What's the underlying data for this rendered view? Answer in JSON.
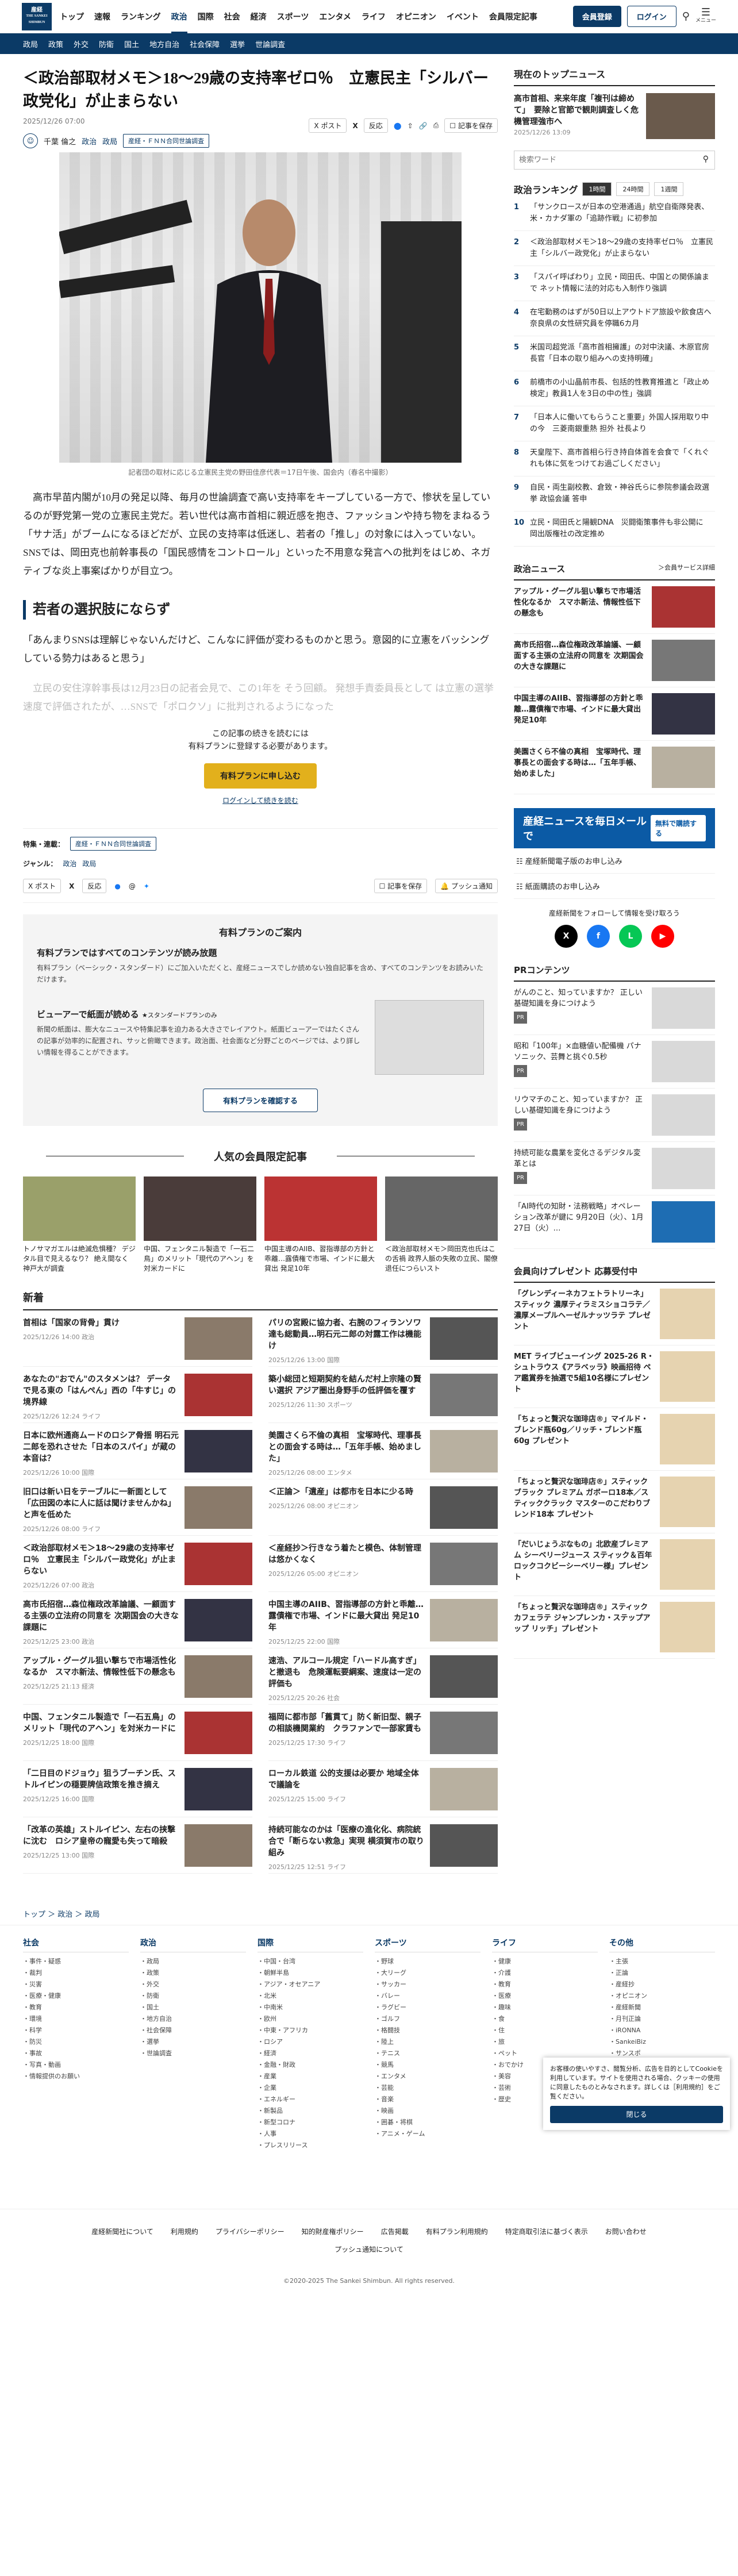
{
  "header": {
    "logo_lines": [
      "産経",
      "THE SANKEI",
      "SHIMBUN"
    ],
    "nav": [
      "トップ",
      "速報",
      "ランキング",
      "政治",
      "国際",
      "社会",
      "経済",
      "スポーツ",
      "エンタメ",
      "ライフ",
      "オピニオン",
      "イベント",
      "会員限定記事"
    ],
    "active": "政治",
    "member_btn": "会員登録",
    "login_btn": "ログイン",
    "search_icon": "search-icon",
    "menu_label": "メニュー"
  },
  "subnav": [
    "政局",
    "政策",
    "外交",
    "防衛",
    "国土",
    "地方自治",
    "社会保障",
    "選挙",
    "世論調査"
  ],
  "article": {
    "title": "＜政治部取材メモ＞18～29歳の支持率ゼロ％　立憲民主「シルバー政党化」が止まらない",
    "date": "2025/12/26 07:00",
    "author": "千葉 倫之",
    "author_tags": [
      "政治",
      "政局"
    ],
    "tag": "産経・ＦＮＮ合同世論調査",
    "share": {
      "post": "ポスト",
      "reaction": "反応",
      "save": "記事を保存"
    },
    "caption": "記者団の取材に応じる立憲民主党の野田佳彦代表＝17日午後、国会内（春名中撮影）",
    "p1": "　高市早苗内閣が10月の発足以降、毎月の世論調査で高い支持率をキープしている一方で、惨状を呈しているのが野党第一党の立憲民主党だ。若い世代は高市首相に親近感を抱き、ファッションや持ち物をまねるう「サナ活」がブームになるほどだが、立民の支持率は低迷し、若者の「推し」の対象には入っていない。SNSでは、岡田克也前幹事長の「国民感情をコントロール」といった不用意な発言への批判をはじめ、ネガティブな炎上事案ばかりが目立つ。",
    "h2": "若者の選択肢にならず",
    "p2": "「あんまりSNSは理解じゃないんだけど、こんなに評価が変わるものかと思う。意図的に立憲をバッシングしている勢力はあると思う」",
    "p3": "　立民の安住淳幹事長は12月23日の記者会見で、この1年を そう回顧。 発想手責委員長として は立憲の選挙速度で評価されたが、…SNSで「ポロクソ」に批判されるようになった",
    "paywall": {
      "line1": "この記事の続きを読むには",
      "line2": "有料プランに登録する必要があります。",
      "btn": "有料プランに申し込む",
      "link": "ログインして続きを読む"
    },
    "meta_label1": "特集・連載：",
    "meta_label2": "ジャンル：",
    "meta_tag": "産経・ＦＮＮ合同世論調査",
    "genre": [
      "政治",
      "政局"
    ],
    "push": "プッシュ通知"
  },
  "plan": {
    "title": "有料プランのご案内",
    "h1": "有料プランではすべてのコンテンツが読み放題",
    "p1": "有料プラン（ベーシック・スタンダード）にご加入いただくと、産経ニュースでしか読めない独自記事を含め、すべてのコンテンツをお読みいただけます。",
    "h2": "ビューアーで紙面が読める",
    "h2s": "★スタンダードプランのみ",
    "p2": "新聞の紙面は、膨大なニュースや特集記事を迫力ある大きさでレイアウト。紙面ビューアーではたくさんの記事が効率的に配置され、サッと俯瞰できます。政治面、社会面など分野ごとのページでは、より詳しい情報を得ることができます。",
    "btn": "有料プランを確認する"
  },
  "popular": {
    "title": "人気の会員限定記事",
    "items": [
      "トノサマガエルは絶滅危惧種？ デジタル目で見えるなり？ 絶え間なく 神戸大が調査",
      "中国、フェンタニル製造で「一石二鳥」のメリット「現代のアヘン」を対米カードに",
      "中国主導のAIIB、習指導部の方針と乖離…露債権で市場、インドに最大貸出 発足10年",
      "＜政治部取材メモ＞岡田克也氏はこの舌禍 政界人脈の失敗の立民、閣僚退任につらいスト"
    ]
  },
  "news": {
    "title": "新着",
    "items": [
      {
        "t": "首相は「国家の背骨」貫け",
        "d": "2025/12/26 14:00",
        "c": "政治"
      },
      {
        "t": "パリの宮殿に協力者、右腕のフィランソワ達も総動員…明石元二郎の対露工作は機能け",
        "d": "2025/12/26 13:00",
        "c": "国際"
      },
      {
        "t": "あなたの\"おでん\"のスタメンは？ データで見る東の「はんぺん」西の「牛すじ」の境界線",
        "d": "2025/12/26 12:24",
        "c": "ライフ"
      },
      {
        "t": "築小総団と短期契約を結んだ村上宗隆の賢い選択 アジア圏出身野手の低評価を覆す",
        "d": "2025/12/26 11:30",
        "c": "スポーツ"
      },
      {
        "t": "日本に欧州通商ムードのロシア骨揺 明石元二郎を恐れさせた「日本のスパイ」が蔵の本音は？",
        "d": "2025/12/26 10:00",
        "c": "国際"
      },
      {
        "t": "美園さくら不倫の真相　宝塚時代、理事長との面会する時は…「五年手帳、始めました」",
        "d": "2025/12/26 08:00",
        "c": "エンタメ"
      },
      {
        "t": "旧口は新い日をテーブルに一新面として「広田図の本に人に話は聞けませんかね」と声を低めた",
        "d": "2025/12/26 08:00",
        "c": "ライフ"
      },
      {
        "t": "＜正論＞「遺産」は都市を日本に少る時",
        "d": "2025/12/26 08:00",
        "c": "オピニオン"
      },
      {
        "t": "＜政治部取材メモ＞18～29歳の支持率ゼロ％　立憲民主「シルバー政党化」が止まらない",
        "d": "2025/12/26 07:00",
        "c": "政治"
      },
      {
        "t": "＜産経抄＞行きなう着たと模色、体制管理は悠かくなく",
        "d": "2025/12/26 05:00",
        "c": "オピニオン"
      },
      {
        "t": "高市氏招宿…森位権政改革論議、一顧面する主張の立法府の同意を 次期国会の大きな課題に",
        "d": "2025/12/25 23:00",
        "c": "政治"
      },
      {
        "t": "中国主導のAIIB、習指導部の方針と乖離…露債権で市場、インドに最大貸出 発足10年",
        "d": "2025/12/25 22:00",
        "c": "国際"
      },
      {
        "t": "アップル・グーグル狙い撃ちで市場活性化なるか　スマホ新法、情報性低下の懸念も",
        "d": "2025/12/25 21:13",
        "c": "経済"
      },
      {
        "t": "速浩、アルコール規定「ハードル高すぎ」と撤退も　危険運転要綱案、速度は一定の評価も",
        "d": "2025/12/25 20:26",
        "c": "社会"
      },
      {
        "t": "中国、フェンタニル製造で「一石五鳥」のメリット「現代のアヘン」を対米カードに",
        "d": "2025/12/25 18:00",
        "c": "国際"
      },
      {
        "t": "福岡に都市部「舊貫て」防く新旧型、親子の相談機関業約　クラファンで一部家賃も",
        "d": "2025/12/25 17:30",
        "c": "ライフ"
      },
      {
        "t": "「二日目のドジョウ」狙うブーチン氏、ストルイピンの穏要牌信政策を推き摘え",
        "d": "2025/12/25 16:00",
        "c": "国際"
      },
      {
        "t": "ローカル鉄道 公的支援は必要か 地域全体で議論を",
        "d": "2025/12/25 15:00",
        "c": "ライフ"
      },
      {
        "t": "「改革の英雄」ストルイピン、左右の挟撃に沈む　ロシア皇帝の寵愛も失って暗殺",
        "d": "2025/12/25 13:00",
        "c": "国際"
      },
      {
        "t": "持続可能なのかは「医療の進化化、病院統合で「断らない救急」実現 横須賀市の取り組み",
        "d": "2025/12/25 12:51",
        "c": "ライフ"
      }
    ]
  },
  "side": {
    "top_title": "現在のトップニュース",
    "top_item": "高市首相、来来年度「複刊は締めて」　要除と官節で観則調査しく危機管理強市へ",
    "top_date": "2025/12/26 13:09",
    "search_placeholder": "検索ワード",
    "rank_title": "政治ランキング",
    "rank_tabs": [
      "1時間",
      "24時間",
      "1週間"
    ],
    "ranking": [
      "「サンクロースが日本の空港通過」航空自衛隊発表、米・カナダ軍の「追跡作戦」に初参加",
      "＜政治部取材メモ＞18～29歳の支持率ゼロ％　立憲民主「シルバー政党化」が止まらない",
      "「スパイ呼ばわり」立民・岡田氏、中国との関係論まで ネット情報に法的対応も入制作り強調",
      "在宅勤務のはずが50日以上アウトドア旅設や飲食店へ　奈良県の女性研究員を停職6カ月",
      "米国司超党派「高市首相擁護」の対中決議、木原官房長官「日本の取り組みへの支持明確」",
      "前橋市の小山晶前市長、包括的性教育推進と「政止め検定」教員1人を3日の中の性」強調",
      "「日本人に働いてもらうこと重要」外国人採用取り中の今　三菱南銀重熱 担外 社長より",
      "天皇陛下、高市首相ら行き持自体首を会食で「くれぐれも体に気をつけてお過ごしください」",
      "自民・両生副校教、倉致・神谷氏らに参院参議会政選挙 政協会議 答申",
      "立民・岡田氏と陽観DNA　災闘衛策事件も非公開に　岡出版権社の改定推め"
    ],
    "cat_title": "政治ニュース",
    "cat_more": "＞会員サービス詳細",
    "cat_items": [
      "アップル・グーグル狙い撃ちで市場活性化なるか　スマホ新法、情報性低下の懸念も",
      "高市氏招宿…森位権政改革論議、一顧面する主張の立法府の同意を 次期国会の大きな課題に",
      "中国主導のAIIB、習指導部の方針と乖離…露債権で市場、インドに最大貸出 発足10年",
      "美園さくら不倫の真相　宝塚時代、理事長との面会する時は…「五年手帳、始めました」"
    ],
    "mail_banner": "産経ニュースを毎日メールで",
    "mail_free": "無料で購読する",
    "links": [
      "産経新聞電子版のお申し込み",
      "紙面購読のお申し込み"
    ],
    "follow": "産経新聞をフォローして情報を受け取ろう",
    "pr_title": "PRコンテンツ",
    "pr_items": [
      "がんのこと、知っていますか？ 正しい基礎知識を身につけよう",
      "昭和「100年」×血糖値い配備機 パナソニック、芸舞と挑ぐ0.5秒",
      "リウマチのこと、知っていますか？ 正しい基礎知識を身につけよう",
      "持続可能な農業を変化さるデジタル変革とは"
    ],
    "pr_badge": "PR",
    "ai_item": "「AI時代の知財・法務戦略」オペレーション改革が鍵に 9月20日（火）、1月27日（火）…",
    "present_title": "会員向けプレゼント 応募受付中",
    "present_items": [
      "「グレンディーネカフェトラトリーネ」スティック 濃厚ティラミスショコラテ／濃厚メープルヘーゼルナッツラテ プレゼント",
      "MET ライブビューイング 2025-26 R・シュトラウス《アラベッラ》映画招待 ペア鑑賞券を抽選で5組10名様にプレゼント",
      "「ちょっと贅沢な珈琲店®」マイルド・ブレンド瓶60g／リッチ・ブレンド瓶60g プレゼント",
      "「ちょっと贅沢な珈琲店®」スティックブラック プレミアム ガボーロ18本／スティッククラック マスターのこだわりブレンド18本 プレゼント",
      "「だいじょうぶなもの」北欧産ブレミアム シーベリージュース スティック＆百年ロックコクビーシーベリー様」プレゼント",
      "「ちょっと贅沢な珈琲店®」スティックカフェラテ ジャンプレンカ・ステップアップ リッチ」プレゼント"
    ]
  },
  "cookie": {
    "text": "お客様の使いやすさ、閲覧分析、広告を目的としてCookieを利用しています。サイトを使用される場合、クッキーの使用に同意したものとみなされます。詳しくは［利用規約］をご覧ください。",
    "close": "閉じる"
  },
  "breadcrumb": "トップ ＞ 政治 ＞ 政局",
  "footer": {
    "cols": [
      {
        "h": "社会",
        "items": [
          "事件・疑惑",
          "裁判",
          "災害",
          "医療・健康",
          "教育",
          "環境",
          "科学",
          "防災",
          "事故",
          "写真・動画",
          "情報提供のお願い"
        ]
      },
      {
        "h": "政治",
        "items": [
          "政局",
          "政策",
          "外交",
          "防衛",
          "国土",
          "地方自治",
          "社会保障",
          "選挙",
          "世論調査"
        ]
      },
      {
        "h": "国際",
        "items": [
          "中国・台湾",
          "朝鮮半島",
          "アジア・オセアニア",
          "北米",
          "中南米",
          "欧州",
          "中東・アフリカ",
          "ロシア",
          "経済",
          "金融・財政",
          "産業",
          "企業",
          "エネルギー",
          "新製品",
          "新型コロナ",
          "人事",
          "プレスリリース"
        ]
      },
      {
        "h": "スポーツ",
        "items": [
          "野球",
          "大リーグ",
          "サッカー",
          "バレー",
          "ラグビー",
          "ゴルフ",
          "格闘技",
          "陸上",
          "テニス",
          "競馬",
          "エンタメ",
          "芸能",
          "音楽",
          "映画",
          "囲碁・将棋",
          "アニメ・ゲーム"
        ]
      },
      {
        "h": "ライフ",
        "items": [
          "健康",
          "介護",
          "教育",
          "医療",
          "趣味",
          "食",
          "住",
          "旅",
          "ペット",
          "おでかけ",
          "美容",
          "芸術",
          "歴史"
        ]
      },
      {
        "h": "その他",
        "items": [
          "主張",
          "正論",
          "産経抄",
          "オピニオン",
          "産経新聞",
          "月刊正論",
          "iRONNA",
          "SankeiBiz",
          "サンスポ",
          "zakzak",
          "夕刊フジ",
          "WEB",
          "MEIXIN",
          "ウェブ産経"
        ]
      }
    ]
  },
  "footer_links": [
    "産経新聞社について",
    "利用規約",
    "プライバシーポリシー",
    "知的財産権ポリシー",
    "広告掲載",
    "有料プラン利用規約",
    "特定商取引法に基づく表示",
    "お問い合わせ"
  ],
  "push_link": "プッシュ通知について",
  "copyright": "©2020-2025 The Sankei Shimbun. All rights reserved."
}
